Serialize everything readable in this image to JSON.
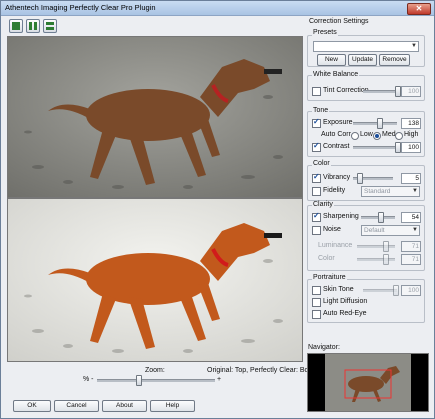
{
  "window": {
    "title": "Athentech Imaging Perfectly Clear Pro Plugin",
    "close_glyph": "✕"
  },
  "view_buttons": [
    {
      "name": "single-view"
    },
    {
      "name": "split-view"
    },
    {
      "name": "stacked-view"
    }
  ],
  "panel": {
    "correction_settings": "Correction Settings",
    "presets": {
      "title": "Presets",
      "selected": "",
      "new_label": "New",
      "update_label": "Update",
      "remove_label": "Remove"
    },
    "white_balance": {
      "title": "White Balance",
      "tint_label": "Tint Correction",
      "tint_checked": false,
      "tint_value": "100",
      "tint_level": 1.0
    },
    "tone": {
      "title": "Tone",
      "exposure_label": "Exposure",
      "exposure_checked": true,
      "exposure_value": "138",
      "exposure_level": 0.6,
      "auto_corr_label": "Auto Corr.",
      "auto_corr_options": [
        "Low",
        "Med",
        "High"
      ],
      "auto_corr_selected": "Med",
      "contrast_label": "Contrast",
      "contrast_checked": true,
      "contrast_value": "100",
      "contrast_level": 1.0
    },
    "color": {
      "title": "Color",
      "vibrancy_label": "Vibrancy",
      "vibrancy_checked": true,
      "vibrancy_value": "5",
      "vibrancy_level": 0.15,
      "fidelity_label": "Fidelity",
      "fidelity_checked": false,
      "fidelity_option": "Standard"
    },
    "clarity": {
      "title": "Clarity",
      "sharpening_label": "Sharpening",
      "sharpening_checked": true,
      "sharpening_value": "54",
      "sharpening_level": 0.55,
      "noise_label": "Noise",
      "noise_checked": false,
      "noise_option": "Default",
      "luminance_label": "Luminance",
      "luminance_value": "71",
      "color_label": "Color",
      "color_value": "71"
    },
    "portraiture": {
      "title": "Portraiture",
      "skin_tone_label": "Skin Tone",
      "skin_tone_checked": false,
      "skin_tone_value": "100",
      "light_diffusion_label": "Light Diffusion",
      "light_diffusion_checked": false,
      "auto_red_eye_label": "Auto Red-Eye",
      "auto_red_eye_checked": false
    },
    "navigator_label": "Navigator:"
  },
  "preview": {
    "zoom_label": "Zoom:",
    "zoom_minus": "% -",
    "zoom_plus": "+",
    "zoom_level": 0.35,
    "legend": "Original: Top, Perfectly Clear: Bottom"
  },
  "buttons": {
    "ok": "OK",
    "cancel": "Cancel",
    "about": "About",
    "help": "Help"
  }
}
